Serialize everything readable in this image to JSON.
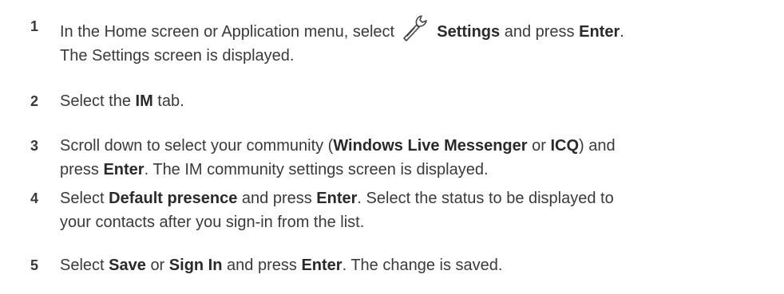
{
  "steps": [
    {
      "number": "1",
      "line1_a": "In the Home screen or Application menu, select",
      "line1_b": "Settings",
      "line1_c": "and press",
      "line1_d": "Enter",
      "line1_e": ".",
      "line2": "The Settings screen is displayed.",
      "icon": "wrench-icon"
    },
    {
      "number": "2",
      "a": "Select the",
      "b": "IM",
      "c": "tab."
    },
    {
      "number": "3",
      "a": "Scroll down to select your community (",
      "b": "Windows Live Messenger",
      "c": "or",
      "d": "ICQ",
      "e": ") and",
      "f": "press",
      "g": "Enter",
      "h": ". The IM community settings screen is displayed."
    },
    {
      "number": "4",
      "a": "Select",
      "b": "Default presence",
      "c": "and press",
      "d": "Enter",
      "e": ". Select the status to be displayed to",
      "f": "your contacts after you sign-in from the list."
    },
    {
      "number": "5",
      "a": "Select",
      "b": "Save",
      "c": "or",
      "d": "Sign In",
      "e": "and press",
      "f": "Enter",
      "g": ". The change is saved."
    }
  ]
}
